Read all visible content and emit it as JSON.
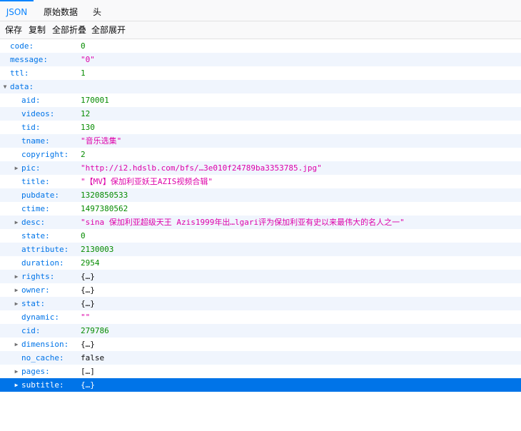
{
  "tabs": [
    {
      "label": "JSON",
      "active": true
    },
    {
      "label": "原始数据",
      "active": false
    },
    {
      "label": "头",
      "active": false
    }
  ],
  "toolbar": {
    "save_label": "保存",
    "copy_label": "复制",
    "collapse_all_label": "全部折叠",
    "expand_all_label": "全部展开"
  },
  "colors": {
    "accent": "#0a84ff",
    "key": "#0074e8",
    "number": "#058b00",
    "string": "#dd00a9",
    "selection": "#0074e8",
    "alt_row": "#f0f5fd"
  },
  "rows": [
    {
      "key": "code:",
      "value": "0",
      "type": "num",
      "depth": 0,
      "twisty": "none"
    },
    {
      "key": "message:",
      "value": "\"0\"",
      "type": "str",
      "depth": 0,
      "twisty": "none"
    },
    {
      "key": "ttl:",
      "value": "1",
      "type": "num",
      "depth": 0,
      "twisty": "none"
    },
    {
      "key": "data:",
      "value": "",
      "type": "coll",
      "depth": 0,
      "twisty": "expanded"
    },
    {
      "key": "aid:",
      "value": "170001",
      "type": "num",
      "depth": 1,
      "twisty": "none"
    },
    {
      "key": "videos:",
      "value": "12",
      "type": "num",
      "depth": 1,
      "twisty": "none"
    },
    {
      "key": "tid:",
      "value": "130",
      "type": "num",
      "depth": 1,
      "twisty": "none"
    },
    {
      "key": "tname:",
      "value": "\"音乐选集\"",
      "type": "str",
      "depth": 1,
      "twisty": "none"
    },
    {
      "key": "copyright:",
      "value": "2",
      "type": "num",
      "depth": 1,
      "twisty": "none"
    },
    {
      "key": "pic:",
      "value": "\"http://i2.hdslb.com/bfs/…3e010f24789ba3353785.jpg\"",
      "type": "str",
      "depth": 1,
      "twisty": "collapsed"
    },
    {
      "key": "title:",
      "value": "\"【MV】保加利亚妖王AZIS视频合辑\"",
      "type": "str",
      "depth": 1,
      "twisty": "none"
    },
    {
      "key": "pubdate:",
      "value": "1320850533",
      "type": "num",
      "depth": 1,
      "twisty": "none"
    },
    {
      "key": "ctime:",
      "value": "1497380562",
      "type": "num",
      "depth": 1,
      "twisty": "none"
    },
    {
      "key": "desc:",
      "value": "\"sina 保加利亚超级天王 Azis1999年出…lgari评为保加利亚有史以来最伟大的名人之一\"",
      "type": "str",
      "depth": 1,
      "twisty": "collapsed"
    },
    {
      "key": "state:",
      "value": "0",
      "type": "num",
      "depth": 1,
      "twisty": "none"
    },
    {
      "key": "attribute:",
      "value": "2130003",
      "type": "num",
      "depth": 1,
      "twisty": "none"
    },
    {
      "key": "duration:",
      "value": "2954",
      "type": "num",
      "depth": 1,
      "twisty": "none"
    },
    {
      "key": "rights:",
      "value": "{…}",
      "type": "coll",
      "depth": 1,
      "twisty": "collapsed"
    },
    {
      "key": "owner:",
      "value": "{…}",
      "type": "coll",
      "depth": 1,
      "twisty": "collapsed"
    },
    {
      "key": "stat:",
      "value": "{…}",
      "type": "coll",
      "depth": 1,
      "twisty": "collapsed"
    },
    {
      "key": "dynamic:",
      "value": "\"\"",
      "type": "str",
      "depth": 1,
      "twisty": "none"
    },
    {
      "key": "cid:",
      "value": "279786",
      "type": "num",
      "depth": 1,
      "twisty": "none"
    },
    {
      "key": "dimension:",
      "value": "{…}",
      "type": "coll",
      "depth": 1,
      "twisty": "collapsed"
    },
    {
      "key": "no_cache:",
      "value": "false",
      "type": "bool",
      "depth": 1,
      "twisty": "none"
    },
    {
      "key": "pages:",
      "value": "[…]",
      "type": "coll",
      "depth": 1,
      "twisty": "collapsed"
    },
    {
      "key": "subtitle:",
      "value": "{…}",
      "type": "coll",
      "depth": 1,
      "twisty": "collapsed",
      "selected": true
    }
  ]
}
